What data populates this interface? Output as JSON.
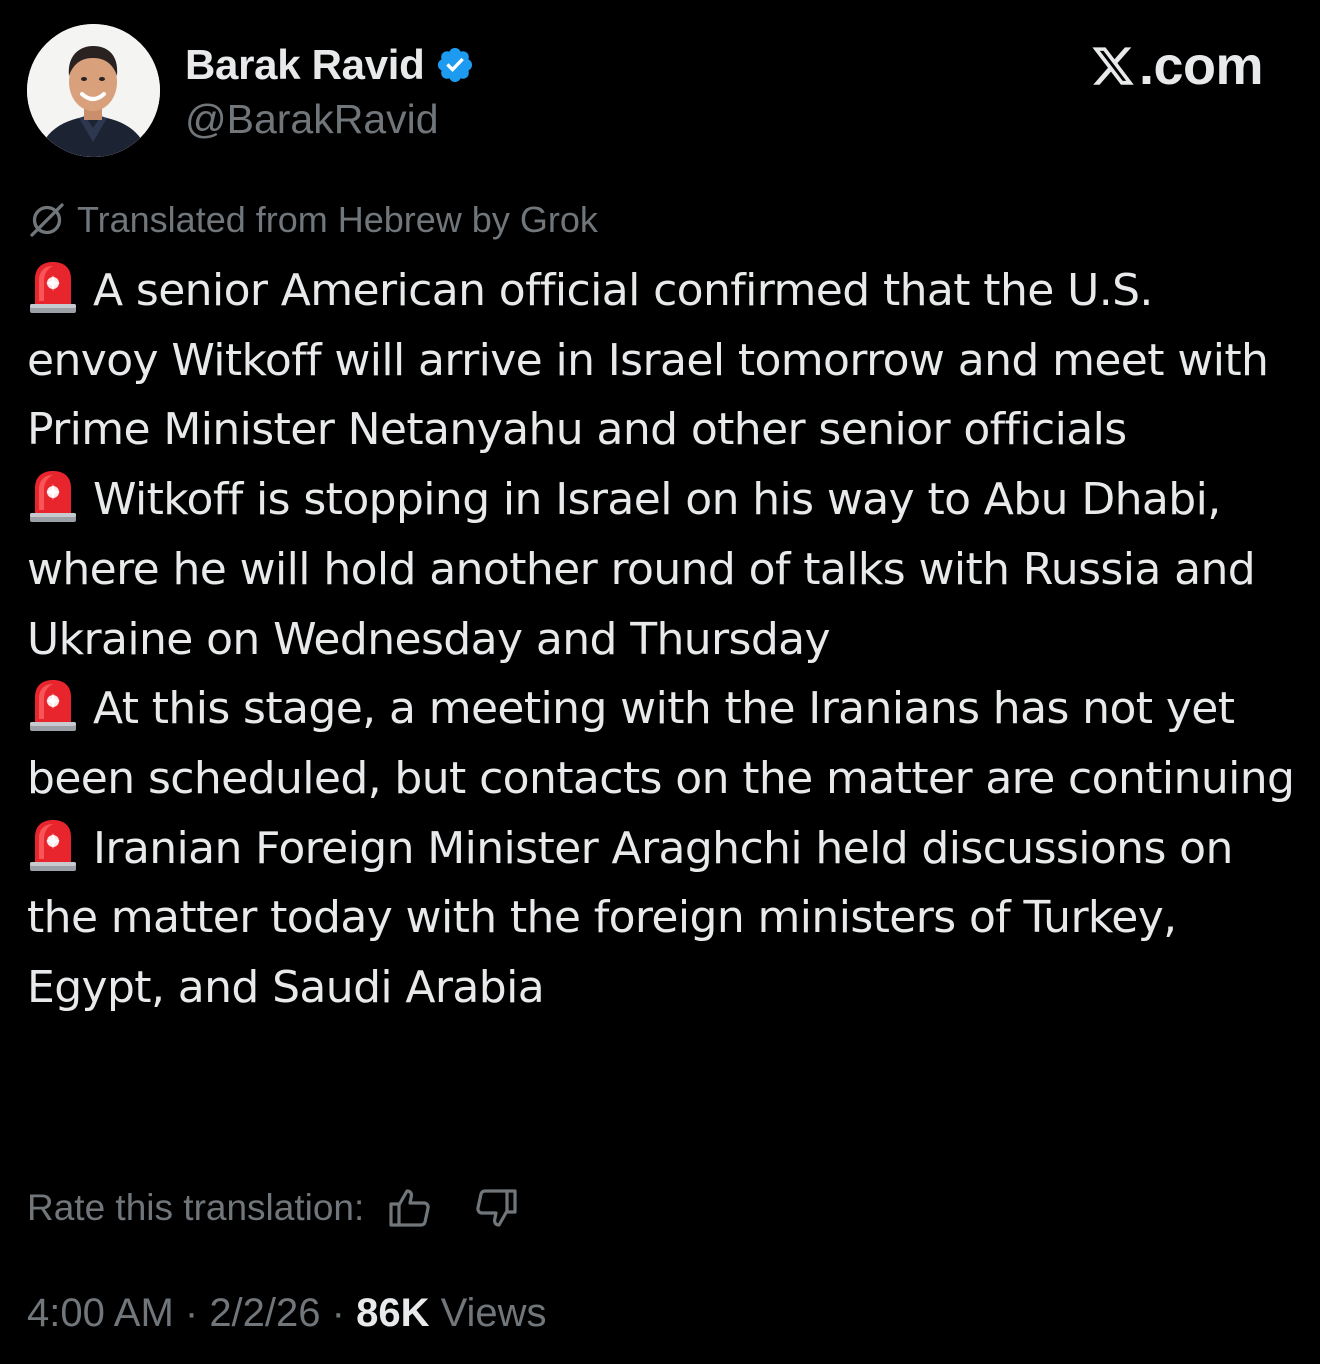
{
  "author": {
    "display_name": "Barak Ravid",
    "handle": "@BarakRavid",
    "verified": true,
    "verified_color": "#1d9bf0"
  },
  "brand": {
    "logo_icon": "x-logo-icon",
    "domain": ".com"
  },
  "translation": {
    "icon": "grok-icon",
    "label": "Translated from Hebrew by Grok"
  },
  "tweet": {
    "paragraphs": [
      {
        "icon": "police-siren-icon",
        "text": "A senior American official confirmed that the U.S. envoy Witkoff will arrive in Israel tomorrow and meet with Prime Minister Netanyahu and other senior officials"
      },
      {
        "icon": "police-siren-icon",
        "text": "Witkoff is stopping in Israel on his way to Abu Dhabi, where he will hold another round of talks with Russia and Ukraine on Wednesday and Thursday"
      },
      {
        "icon": "police-siren-icon",
        "text": "At this stage, a meeting with the Iranians has not yet been scheduled, but contacts on the matter are continuing"
      },
      {
        "icon": "police-siren-icon",
        "text": "Iranian Foreign Minister Araghchi held discussions on the matter today with the foreign ministers of Turkey, Egypt, and Saudi Arabia"
      }
    ]
  },
  "rating": {
    "label": "Rate this translation:",
    "up_icon": "thumbs-up-icon",
    "down_icon": "thumbs-down-icon"
  },
  "meta": {
    "time": "4:00 AM",
    "separator": " · ",
    "date": "2/2/26",
    "views_count": "86K",
    "views_label": " Views"
  },
  "colors": {
    "background": "#000000",
    "primary_text": "#e7e9ea",
    "secondary_text": "#71767b",
    "accent": "#1d9bf0"
  }
}
